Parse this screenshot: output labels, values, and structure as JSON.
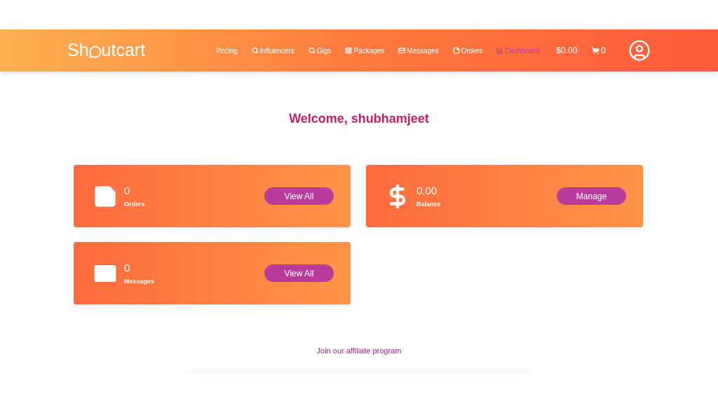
{
  "logo": {
    "before": "Sh",
    "after": "utcart"
  },
  "nav": [
    {
      "label": "Pricing",
      "selected": false
    },
    {
      "label": "Influencers",
      "selected": false
    },
    {
      "label": "Gigs",
      "selected": false
    },
    {
      "label": "Packages",
      "selected": false
    },
    {
      "label": "Messages",
      "selected": false
    },
    {
      "label": "Orders",
      "selected": false
    },
    {
      "label": "Dashboard",
      "selected": true
    }
  ],
  "balance": "$0.00",
  "cart_count": "0",
  "welcome": "Welcome, shubhamjeet",
  "cards": [
    {
      "kind": "orders",
      "value": "0",
      "label": "Orders",
      "button": "View All"
    },
    {
      "kind": "balance",
      "value": "0.00",
      "label": "Balance",
      "button": "Manage"
    },
    {
      "kind": "messages",
      "value": "0",
      "label": "Messages",
      "button": "View All"
    }
  ],
  "affiliate_link": "Join our affiliate program"
}
